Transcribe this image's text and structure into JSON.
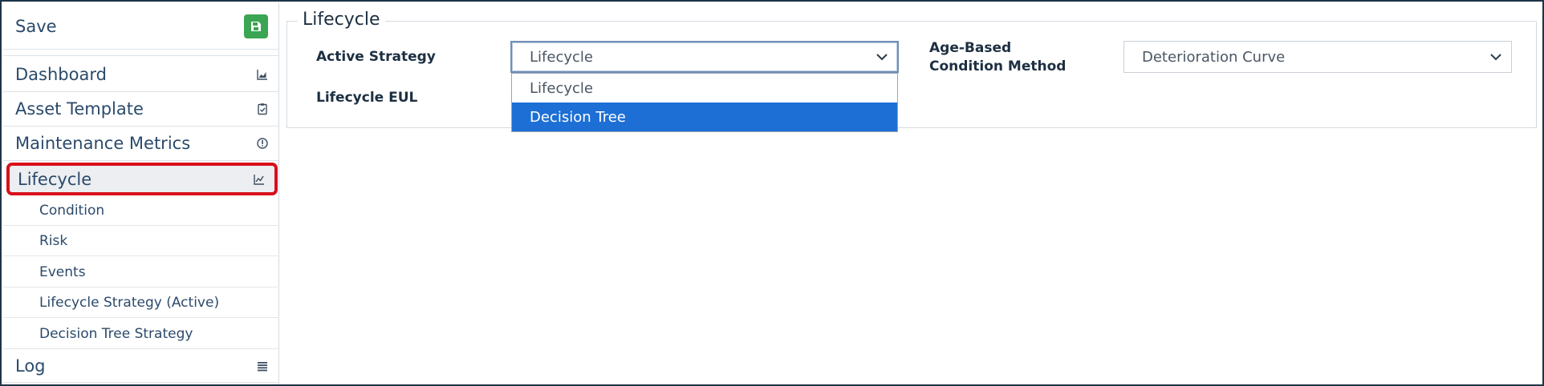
{
  "sidebar": {
    "save_label": "Save",
    "items": [
      {
        "label": "Dashboard",
        "icon": "area-chart-icon"
      },
      {
        "label": "Asset Template",
        "icon": "clipboard-check-icon"
      },
      {
        "label": "Maintenance Metrics",
        "icon": "info-circle-icon"
      },
      {
        "label": "Lifecycle",
        "icon": "line-chart-icon",
        "selected": true
      },
      {
        "label": "Log",
        "icon": "list-icon"
      }
    ],
    "subitems": [
      {
        "label": "Condition"
      },
      {
        "label": "Risk"
      },
      {
        "label": "Events"
      },
      {
        "label": "Lifecycle Strategy (Active)"
      },
      {
        "label": "Decision Tree Strategy"
      }
    ]
  },
  "main": {
    "section_title": "Lifecycle",
    "active_strategy": {
      "label": "Active Strategy",
      "value": "Lifecycle",
      "options": [
        "Lifecycle",
        "Decision Tree"
      ],
      "highlighted": "Decision Tree"
    },
    "lifecycle_eul": {
      "label": "Lifecycle EUL"
    },
    "age_based": {
      "label": "Age-Based Condition Method",
      "value": "Deterioration Curve"
    }
  },
  "colors": {
    "save_button": "#3aa552",
    "selected_outline": "#d8101a",
    "dropdown_highlight": "#1d6fd6",
    "link_text": "#2b4a6b"
  }
}
